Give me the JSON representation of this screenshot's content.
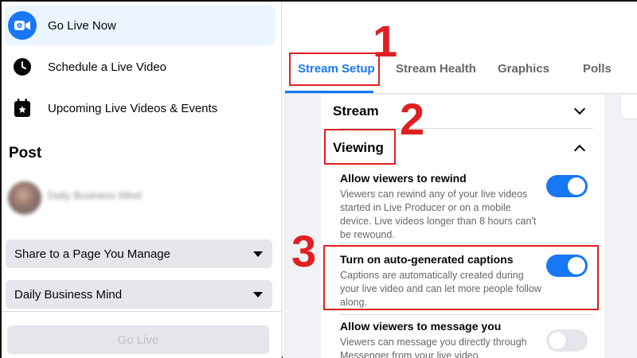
{
  "sidebar": {
    "items": [
      {
        "label": "Go Live Now",
        "icon": "video-camera-icon",
        "active": true
      },
      {
        "label": "Schedule a Live Video",
        "icon": "clock-icon"
      },
      {
        "label": "Upcoming Live Videos & Events",
        "icon": "calendar-star-icon"
      }
    ],
    "post_heading": "Post",
    "profile_name": "Daily Business Mind",
    "share_select": "Share to a Page You Manage",
    "page_select": "Daily Business Mind",
    "go_live_button": "Go Live"
  },
  "tabs": [
    {
      "label": "Stream Setup",
      "active": true
    },
    {
      "label": "Stream Health"
    },
    {
      "label": "Graphics"
    },
    {
      "label": "Polls"
    }
  ],
  "sections": {
    "stream": "Stream",
    "viewing": "Viewing"
  },
  "settings": [
    {
      "title": "Allow viewers to rewind",
      "desc": "Viewers can rewind any of your live videos started in Live Producer or on a mobile device. Live videos longer than 8 hours can't be rewound.",
      "enabled": true
    },
    {
      "title": "Turn on auto-generated captions",
      "desc": "Captions are automatically created during your live video and can let more people follow along.",
      "enabled": true
    },
    {
      "title": "Allow viewers to message you",
      "desc": "Viewers can message you directly through Messenger from your live video.",
      "enabled": false
    }
  ],
  "annotations": {
    "step1": "1",
    "step2": "2",
    "step3": "3",
    "color": "#e02020"
  },
  "colors": {
    "accent": "#1877f2",
    "active_nav_bg": "#ebf5ff",
    "muted_text": "#65676b"
  }
}
